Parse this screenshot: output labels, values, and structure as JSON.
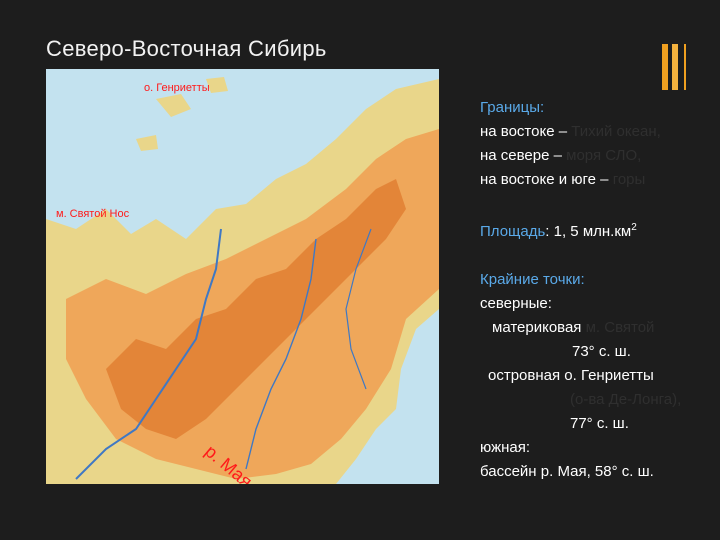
{
  "slide": {
    "title": "Северо-Восточная Сибирь"
  },
  "map": {
    "labels": {
      "henrietta": "о. Генриетты",
      "svyatoy_nos": "м. Святой Нос",
      "maya_river": "р. Мая"
    },
    "colors": {
      "sea": "#c3e2ef",
      "lowland": "#e9d68a",
      "upland": "#efa75a",
      "mountain": "#e07f32",
      "river": "#3f78c4"
    }
  },
  "info": {
    "borders_heading": "Границы:",
    "border_east": "на востоке –",
    "border_east_faded": "Тихий океан,",
    "border_north": "на севере –",
    "border_north_faded": "моря СЛО,",
    "border_east_south": "на востоке и юге –",
    "border_east_south_faded": "горы",
    "area_label": "Площадь",
    "area_value": ": 1, 5 млн.км",
    "area_sup": "2",
    "extreme_heading": "Крайние точки:",
    "north_label": "северные:",
    "mainland_label": "материковая",
    "mainland_faded": "м. Святой",
    "mainland_lat": "73° с. ш.",
    "island_label": "островная",
    "island_name": "о. Генриетты",
    "island_faded": "(о-ва Де-Лонга),",
    "island_lat": "77° с. ш.",
    "south_label": "южная:",
    "south_value": "бассейн р. Мая,  58° с. ш."
  }
}
